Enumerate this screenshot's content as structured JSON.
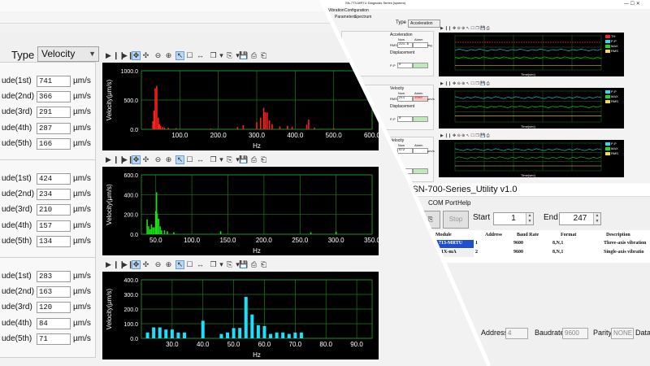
{
  "main": {
    "type_label": "Type",
    "type_value": "Velocity",
    "unit": "µm/s",
    "groups": [
      {
        "rows": [
          {
            "label": "ude(1st)",
            "value": "741"
          },
          {
            "label": "ude(2nd)",
            "value": "366"
          },
          {
            "label": "ude(3rd)",
            "value": "291"
          },
          {
            "label": "ude(4th)",
            "value": "287"
          },
          {
            "label": "ude(5th)",
            "value": "166"
          }
        ]
      },
      {
        "rows": [
          {
            "label": "ude(1st)",
            "value": "424"
          },
          {
            "label": "ude(2nd)",
            "value": "234"
          },
          {
            "label": "ude(3rd)",
            "value": "210"
          },
          {
            "label": "ude(4th)",
            "value": "157"
          },
          {
            "label": "ude(5th)",
            "value": "134"
          }
        ]
      },
      {
        "rows": [
          {
            "label": "ude(1st)",
            "value": "283"
          },
          {
            "label": "ude(2nd)",
            "value": "163"
          },
          {
            "label": "ude(3rd)",
            "value": "120"
          },
          {
            "label": "ude(4th)",
            "value": "84"
          },
          {
            "label": "ude(5th)",
            "value": "71"
          }
        ]
      }
    ]
  },
  "chart_data": [
    {
      "type": "bar",
      "color": "#ff2020",
      "xlabel": "Hz",
      "ylabel": "Velocity(µm/s)",
      "xlim": [
        0,
        600
      ],
      "ylim": [
        0,
        1000
      ],
      "xticks": [
        "100.0",
        "200.0",
        "300.0",
        "400.0",
        "500.0",
        "600.0"
      ],
      "yticks": [
        "0.0",
        "500.0",
        "1000.0"
      ],
      "bars": [
        [
          30,
          140
        ],
        [
          33,
          320
        ],
        [
          36,
          700
        ],
        [
          40,
          741
        ],
        [
          44,
          200
        ],
        [
          47,
          90
        ],
        [
          50,
          60
        ],
        [
          55,
          40
        ],
        [
          60,
          30
        ],
        [
          70,
          25
        ],
        [
          90,
          20
        ],
        [
          180,
          15
        ],
        [
          250,
          40
        ],
        [
          265,
          70
        ],
        [
          300,
          120
        ],
        [
          310,
          200
        ],
        [
          318,
          366
        ],
        [
          322,
          291
        ],
        [
          327,
          287
        ],
        [
          333,
          150
        ],
        [
          340,
          90
        ],
        [
          360,
          50
        ],
        [
          380,
          60
        ],
        [
          392,
          40
        ],
        [
          430,
          80
        ],
        [
          435,
          166
        ],
        [
          450,
          30
        ],
        [
          500,
          20
        ]
      ]
    },
    {
      "type": "bar",
      "color": "#18e018",
      "xlabel": "Hz",
      "ylabel": "Velocity(µm/s)",
      "xlim": [
        30,
        350
      ],
      "ylim": [
        0,
        600
      ],
      "xticks": [
        "50.0",
        "100.0",
        "150.0",
        "200.0",
        "250.0",
        "300.0",
        "350.0"
      ],
      "yticks": [
        "0.0",
        "200.0",
        "400.0",
        "600.0"
      ],
      "bars": [
        [
          38,
          150
        ],
        [
          40,
          80
        ],
        [
          42,
          50
        ],
        [
          44,
          100
        ],
        [
          46,
          70
        ],
        [
          48,
          70
        ],
        [
          50,
          234
        ],
        [
          51,
          424
        ],
        [
          52,
          210
        ],
        [
          54,
          157
        ],
        [
          56,
          80
        ],
        [
          58,
          40
        ],
        [
          62,
          40
        ],
        [
          66,
          30
        ],
        [
          75,
          20
        ],
        [
          140,
          30
        ],
        [
          265,
          20
        ],
        [
          300,
          25
        ]
      ]
    },
    {
      "type": "bar",
      "color": "#18e0ff",
      "xlabel": "Hz",
      "ylabel": "Velocity(µm/s)",
      "xlim": [
        20,
        95
      ],
      "ylim": [
        0,
        400
      ],
      "xticks": [
        "30.0",
        "40.0",
        "50.0",
        "60.0",
        "70.0",
        "80.0",
        "90.0"
      ],
      "yticks": [
        "0.0",
        "100.0",
        "200.0",
        "300.0",
        "400.0"
      ],
      "bars": [
        [
          22,
          40
        ],
        [
          24,
          75
        ],
        [
          26,
          75
        ],
        [
          28,
          60
        ],
        [
          30,
          60
        ],
        [
          32,
          40
        ],
        [
          34,
          40
        ],
        [
          40,
          120
        ],
        [
          46,
          30
        ],
        [
          48,
          40
        ],
        [
          50,
          70
        ],
        [
          52,
          71
        ],
        [
          54,
          283
        ],
        [
          56,
          163
        ],
        [
          58,
          90
        ],
        [
          60,
          84
        ],
        [
          62,
          30
        ],
        [
          64,
          40
        ],
        [
          66,
          40
        ],
        [
          68,
          30
        ],
        [
          70,
          40
        ],
        [
          72,
          40
        ]
      ]
    }
  ],
  "diagnosis_window": {
    "title": "SN-7T3-MRTU Diagnosis Series (system)",
    "menu": [
      "Vibration",
      "Configuration"
    ],
    "subtabs": [
      "Parameters",
      "Spectrum"
    ],
    "type_label": "Type",
    "type_value": "Acceleration",
    "groups": [
      {
        "title": "Acceleration",
        "rms_label": "RMS",
        "rms_value": "221.8",
        "unit": "mg",
        "pp_label": "P-P",
        "pp_value": "0"
      },
      {
        "title": "Velocity",
        "rms_label": "RMS",
        "rms_value": "211",
        "unit": "µm/s",
        "alarm": "1000",
        "pp_label": "P-P",
        "pp_value": "0"
      },
      {
        "title": "Velocity",
        "rms_label": "RMS",
        "rms_value": "972",
        "unit": "µm/s",
        "pp_label": "P-P",
        "pp_value": "0"
      }
    ],
    "group_subtitles": [
      "Displacement",
      "Displacement"
    ],
    "col_labels": [
      "Now",
      "Alarm"
    ],
    "charts": [
      {
        "legend": [
          {
            "name": "TH",
            "color": "#ff2020"
          },
          {
            "name": "P-P",
            "color": "#18e0ff"
          },
          {
            "name": "MAX",
            "color": "#18e018"
          },
          {
            "name": "RMS",
            "color": "#ffe020"
          }
        ]
      },
      {
        "legend": [
          {
            "name": "P-P",
            "color": "#18e0ff"
          },
          {
            "name": "MAX",
            "color": "#18e018"
          },
          {
            "name": "RMS",
            "color": "#ffe020"
          }
        ]
      },
      {
        "legend": [
          {
            "name": "P-P",
            "color": "#18e0ff"
          },
          {
            "name": "MAX",
            "color": "#18e018"
          },
          {
            "name": "RMS",
            "color": "#ffe020"
          }
        ]
      }
    ],
    "xlabel": "Time(sec)"
  },
  "utility_window": {
    "title": "iSN-700-Series_Utility v1.0",
    "menu": [
      "COM Port",
      "Help"
    ],
    "stop_label": "Stop",
    "start_label": "Start",
    "start_value": "1",
    "end_label": "End",
    "end_value": "247",
    "columns": [
      "Module",
      "Address",
      "Baud Rate",
      "Format",
      "Description"
    ],
    "rows": [
      {
        "module": "713-MRTU",
        "address": "1",
        "baud": "9600",
        "format": "8,N,1",
        "desc": "Three-axis vibration"
      },
      {
        "module": "01X-mA",
        "address": "2",
        "baud": "9600",
        "format": "8,N,1",
        "desc": "Single-axis vibratio"
      }
    ],
    "bottom": [
      {
        "label": "Address",
        "value": "4"
      },
      {
        "label": "Baudrate",
        "value": "9600"
      },
      {
        "label": "Parity",
        "value": "NONE"
      },
      {
        "label": "Data",
        "value": ""
      }
    ]
  }
}
